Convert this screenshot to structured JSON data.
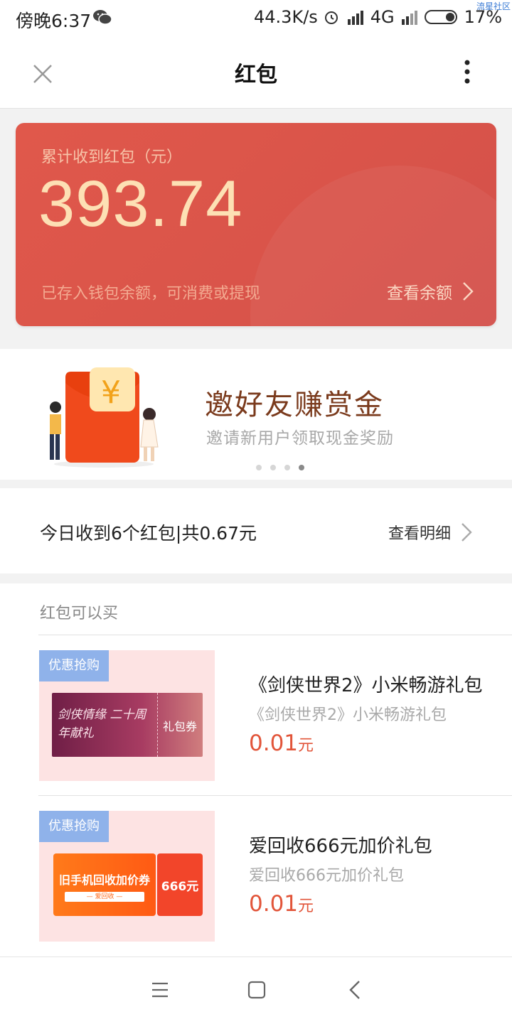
{
  "status_bar": {
    "time": "傍晚6:37",
    "speed": "44.3K/s",
    "network": "4G",
    "battery": "17%",
    "watermark": "流星社区"
  },
  "header": {
    "title": "红包"
  },
  "balance": {
    "label": "累计收到红包（元）",
    "amount": "393.74",
    "note": "已存入钱包余额，可消费或提现",
    "view_label": "查看余额"
  },
  "banner": {
    "title": "邀好友赚赏金",
    "subtitle": "邀请新用户领取现金奖励",
    "page_count": 4,
    "active_page": 4
  },
  "today": {
    "text": "今日收到6个红包|共0.67元",
    "detail_label": "查看明细"
  },
  "buy_section": {
    "heading": "红包可以买",
    "items": [
      {
        "badge": "优惠抢购",
        "title": "《剑侠世界2》小米畅游礼包",
        "subtitle": "《剑侠世界2》小米畅游礼包",
        "price": "0.01",
        "unit": "元",
        "thumb_art": "剑侠情缘 二十周年献礼",
        "thumb_tag": "礼包券"
      },
      {
        "badge": "优惠抢购",
        "title": "爱回收666元加价礼包",
        "subtitle": "爱回收666元加价礼包",
        "price": "0.01",
        "unit": "元",
        "thumb_art": "旧手机回收加价券",
        "thumb_small": "— 爱回收 —",
        "thumb_tag": "666元"
      }
    ]
  },
  "colors": {
    "card": "#d9544a",
    "price": "#e2553a",
    "badge": "#8fb2ea"
  }
}
